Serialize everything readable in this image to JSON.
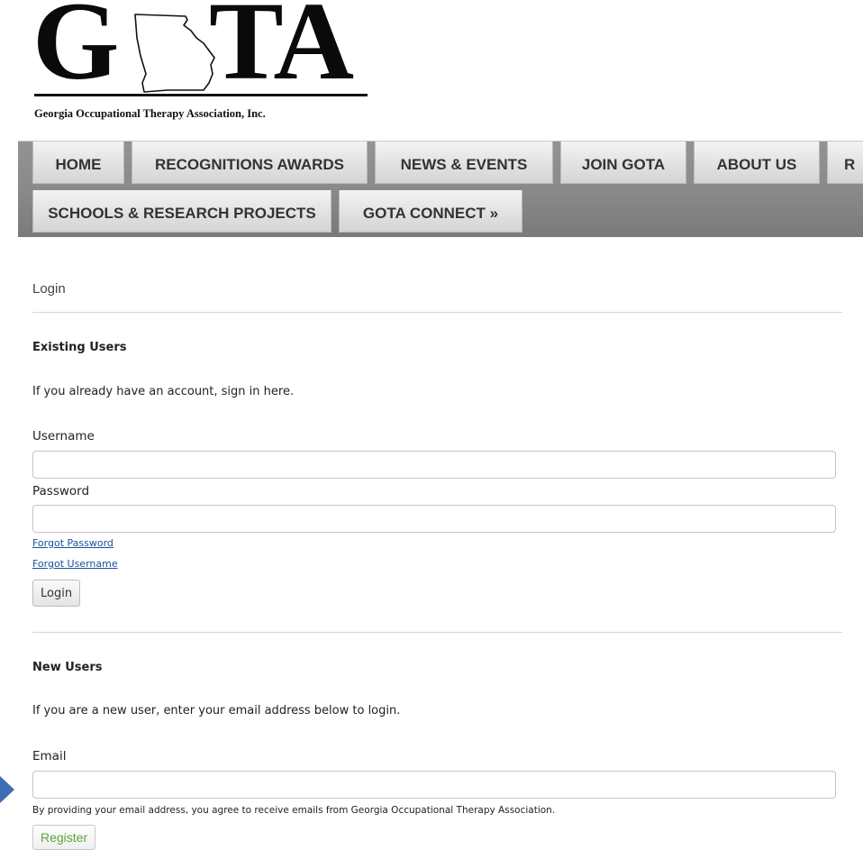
{
  "logo": {
    "letter_g": "G",
    "letters_ta": "TA",
    "tagline": "Georgia Occupational Therapy Association, Inc."
  },
  "nav": {
    "row1": [
      "HOME",
      "RECOGNITIONS AWARDS",
      "NEWS & EVENTS",
      "JOIN GOTA",
      "ABOUT US",
      "R"
    ],
    "row2": [
      "SCHOOLS & RESEARCH PROJECTS",
      "GOTA CONNECT »"
    ]
  },
  "page": {
    "title": "Login"
  },
  "existing": {
    "heading": "Existing Users",
    "intro": "If you already have an account, sign in here.",
    "username_label": "Username",
    "username_value": "",
    "password_label": "Password",
    "password_value": "",
    "forgot_password": "Forgot Password",
    "forgot_username": "Forgot Username",
    "login_button": "Login"
  },
  "newusers": {
    "heading": "New Users",
    "intro": "If you are a new user, enter your email address below to login.",
    "email_label": "Email",
    "email_value": "",
    "disclaimer": "By providing your email address, you agree to receive emails from Georgia Occupational Therapy Association.",
    "register_button": "Register"
  },
  "colors": {
    "nav_bar": "#8a8a8a",
    "link": "#1b4f9c",
    "register_text": "#5aa63c",
    "marker_arrow": "#3d6db5"
  }
}
